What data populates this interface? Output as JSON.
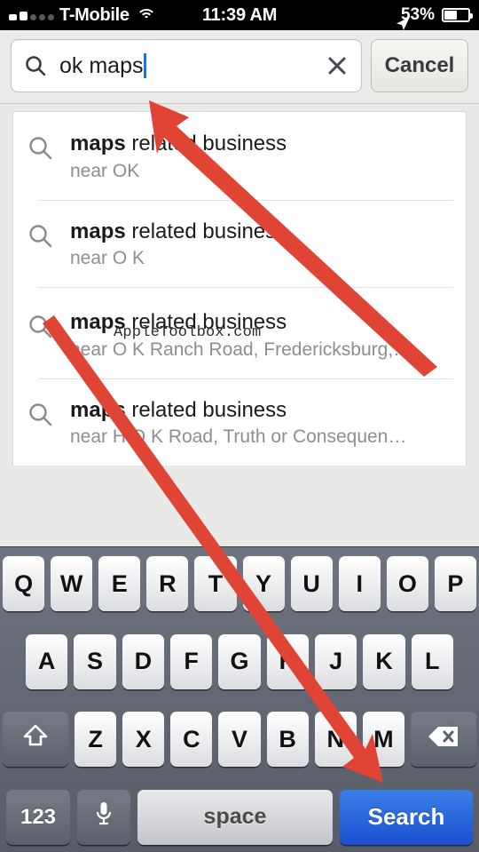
{
  "status_bar": {
    "carrier": "T-Mobile",
    "time": "11:39 AM",
    "battery_percent": "53%",
    "signal_bars_filled": 2,
    "signal_bars_total": 5,
    "wifi_icon": "wifi-icon",
    "location_icon": "location-arrow-icon",
    "battery_icon": "battery-icon"
  },
  "search": {
    "value": "ok maps",
    "search_icon": "search-icon",
    "clear_icon": "close-x-icon",
    "cancel_label": "Cancel"
  },
  "suggestions": [
    {
      "icon": "search-icon",
      "query_bold": "maps",
      "query_rest": " related business",
      "subtitle": "near OK"
    },
    {
      "icon": "search-icon",
      "query_bold": "maps",
      "query_rest": " related business",
      "subtitle": "near O K"
    },
    {
      "icon": "search-icon",
      "query_bold": "maps",
      "query_rest": " related business",
      "subtitle": "near O K Ranch Road, Fredericksburg,…"
    },
    {
      "icon": "search-icon",
      "query_bold": "maps",
      "query_rest": " related business",
      "subtitle": "near H O K Road, Truth or Consequen…"
    }
  ],
  "watermark": "AppleToolbox.com",
  "keyboard": {
    "row1": [
      "Q",
      "W",
      "E",
      "R",
      "T",
      "Y",
      "U",
      "I",
      "O",
      "P"
    ],
    "row2": [
      "A",
      "S",
      "D",
      "F",
      "G",
      "H",
      "J",
      "K",
      "L"
    ],
    "row3": [
      "Z",
      "X",
      "C",
      "V",
      "B",
      "N",
      "M"
    ],
    "shift_icon": "shift-arrow-icon",
    "backspace_icon": "backspace-icon",
    "numbers_label": "123",
    "mic_icon": "microphone-icon",
    "space_label": "space",
    "search_label": "Search"
  },
  "annotations": {
    "arrow_color": "#e04434",
    "arrow_1_target": "search-field",
    "arrow_2_target": "search-key"
  }
}
